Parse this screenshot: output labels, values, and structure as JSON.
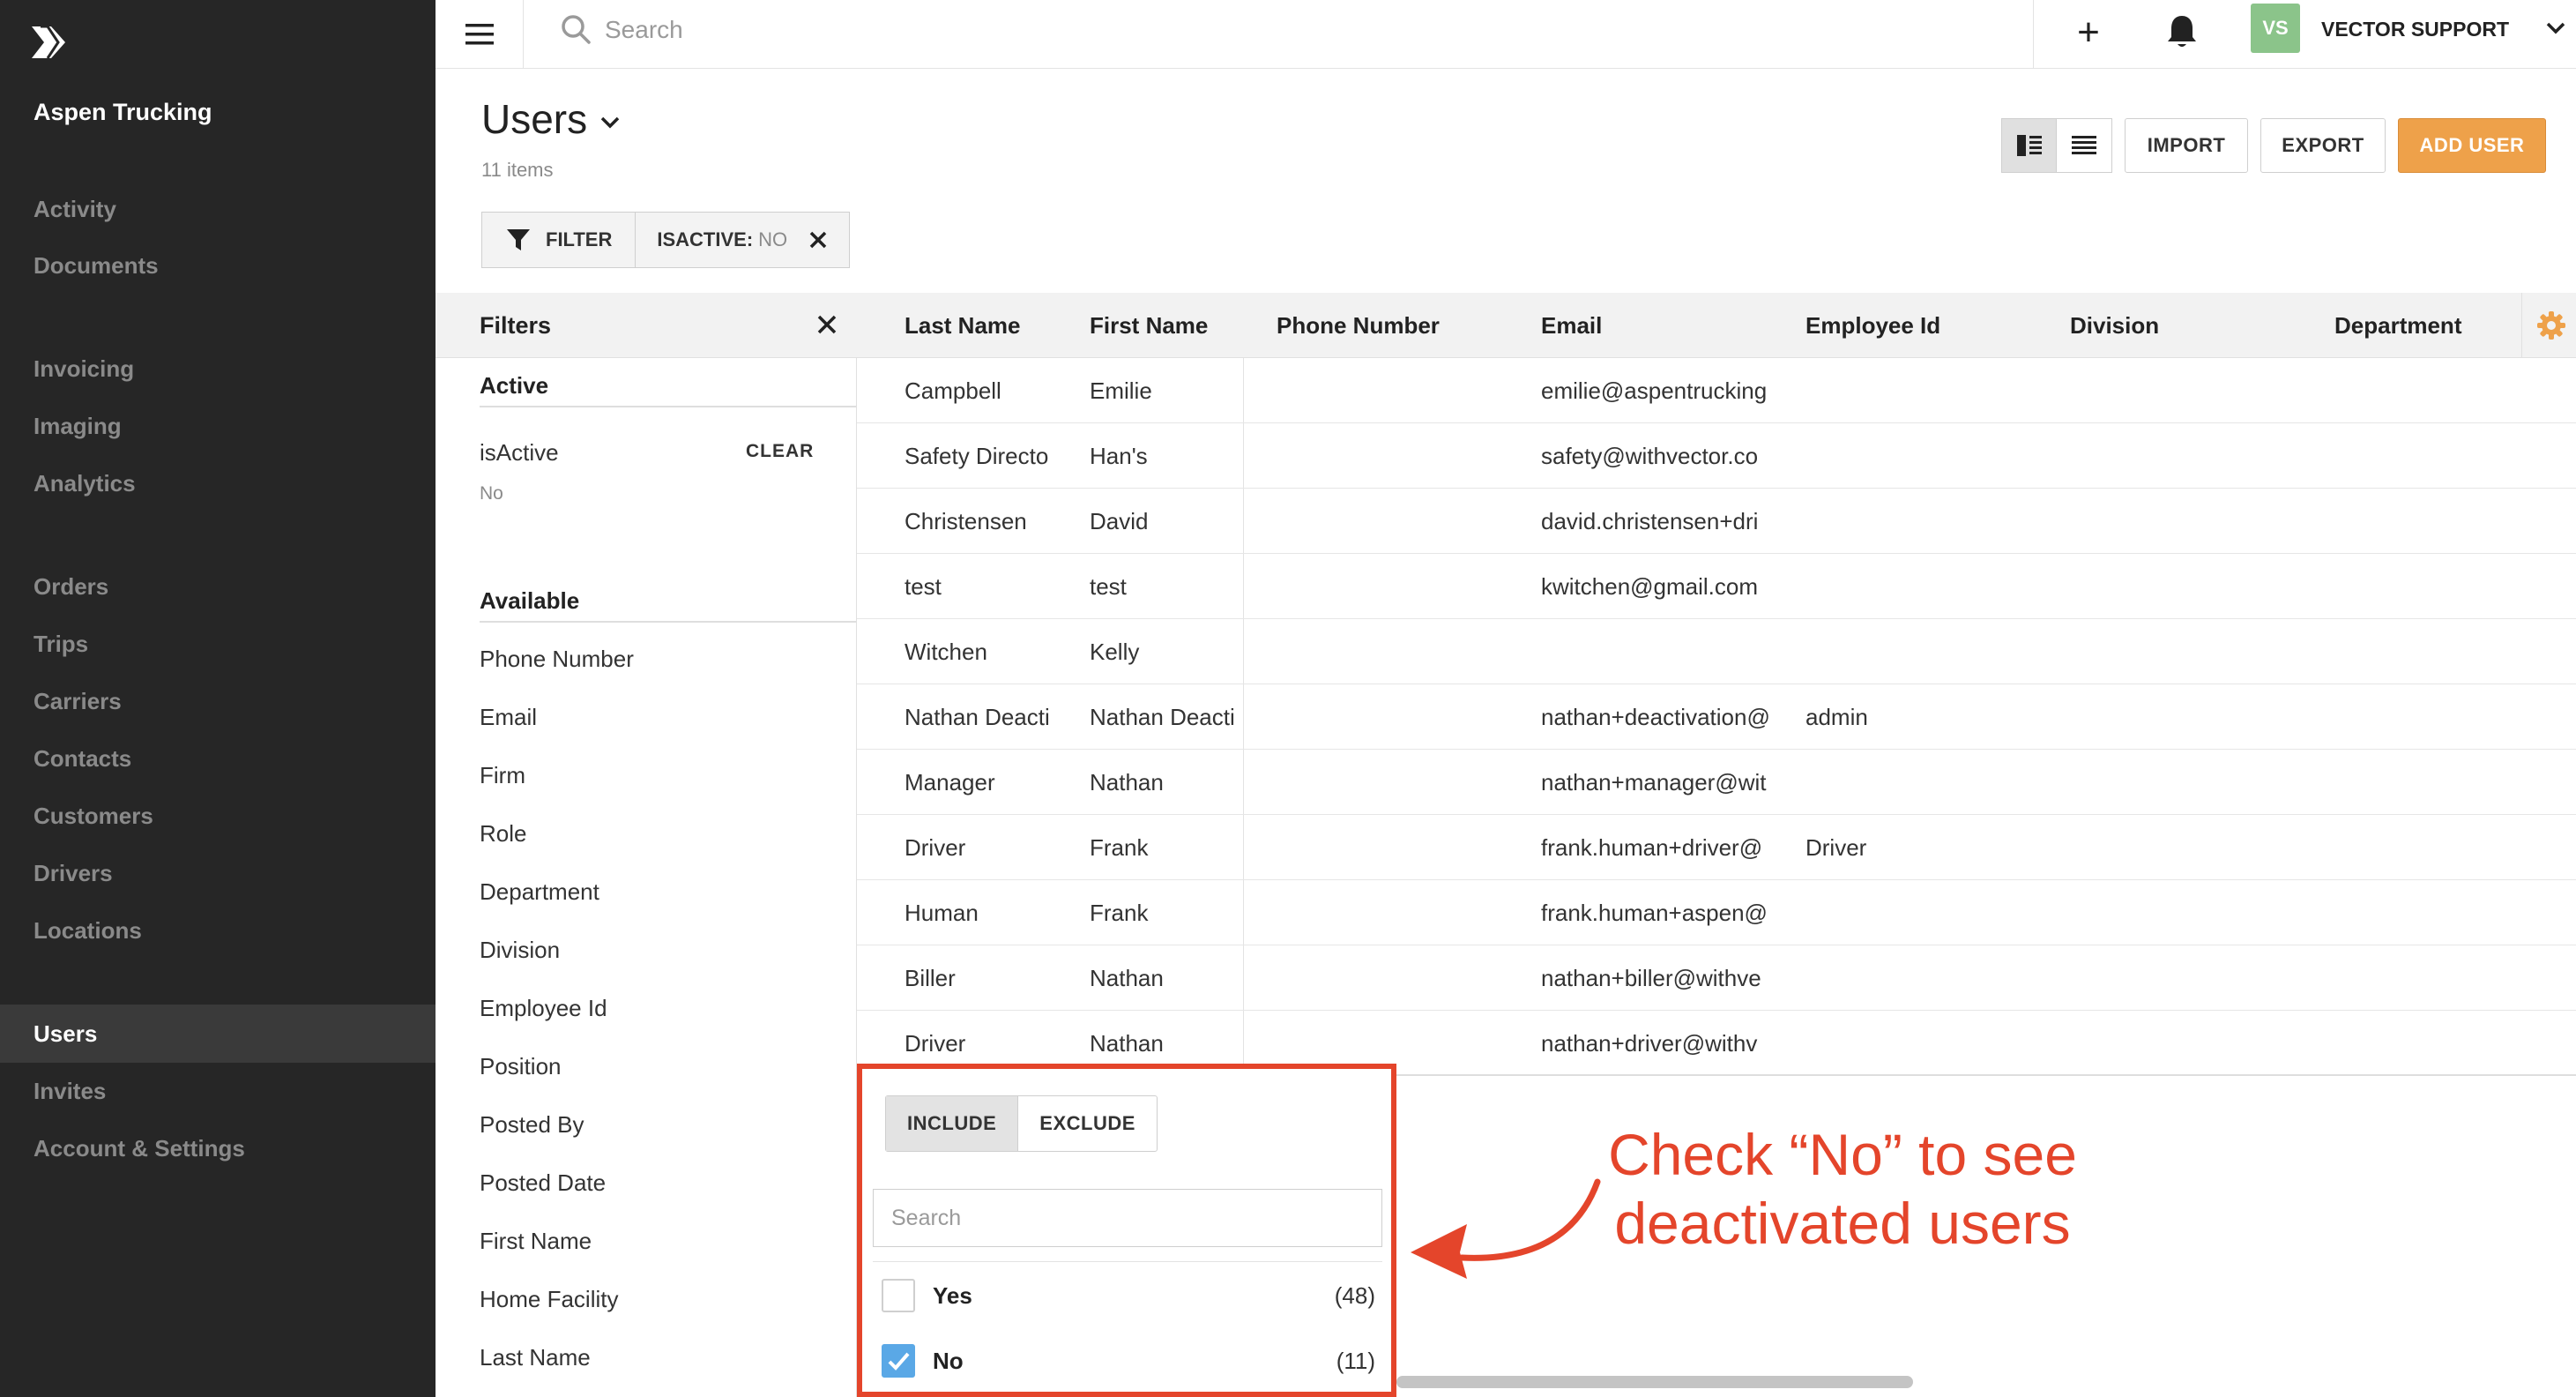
{
  "sidebar": {
    "org_name": "Aspen Trucking",
    "items": [
      {
        "label": "Activity",
        "name": "activity"
      },
      {
        "label": "Documents",
        "name": "documents"
      },
      {
        "label": "Invoicing",
        "name": "invoicing"
      },
      {
        "label": "Imaging",
        "name": "imaging"
      },
      {
        "label": "Analytics",
        "name": "analytics"
      },
      {
        "label": "Orders",
        "name": "orders"
      },
      {
        "label": "Trips",
        "name": "trips"
      },
      {
        "label": "Carriers",
        "name": "carriers"
      },
      {
        "label": "Contacts",
        "name": "contacts"
      },
      {
        "label": "Customers",
        "name": "customers"
      },
      {
        "label": "Drivers",
        "name": "drivers"
      },
      {
        "label": "Locations",
        "name": "locations"
      },
      {
        "label": "Users",
        "name": "users",
        "active": true
      },
      {
        "label": "Invites",
        "name": "invites"
      },
      {
        "label": "Account & Settings",
        "name": "account-settings"
      }
    ]
  },
  "topbar": {
    "search_placeholder": "Search",
    "avatar_initials": "VS",
    "avatar_color": "#8bc48a",
    "account_name": "VECTOR SUPPORT",
    "icons": [
      "menu-icon",
      "search-icon",
      "plus-icon",
      "bell-icon",
      "chevron-down-icon"
    ]
  },
  "page": {
    "title": "Users",
    "item_count": "11 items"
  },
  "toolbar": {
    "import_label": "IMPORT",
    "export_label": "EXPORT",
    "add_user_label": "ADD USER",
    "accent_color": "#eea14a"
  },
  "filter_bar": {
    "filter_label": "FILTER",
    "chip_key": "ISACTIVE:",
    "chip_value": "NO"
  },
  "filters_panel": {
    "title": "Filters",
    "active_section": "Active",
    "active_filter": {
      "field": "isActive",
      "clear_label": "CLEAR",
      "value": "No"
    },
    "available_section": "Available",
    "available": [
      "Phone Number",
      "Email",
      "Firm",
      "Role",
      "Department",
      "Division",
      "Employee Id",
      "Position",
      "Posted By",
      "Posted Date",
      "First Name",
      "Home Facility",
      "Last Name"
    ]
  },
  "table": {
    "columns": [
      "Last Name",
      "First Name",
      "Phone Number",
      "Email",
      "Employee Id",
      "Division",
      "Department"
    ],
    "rows": [
      {
        "last": "Campbell",
        "first": "Emilie",
        "phone": "",
        "email": "emilie@aspentrucking",
        "employee_id": ""
      },
      {
        "last": "Safety Directo",
        "first": "Han's",
        "phone": "",
        "email": "safety@withvector.co",
        "employee_id": ""
      },
      {
        "last": "Christensen",
        "first": "David",
        "phone": "",
        "email": "david.christensen+dri",
        "employee_id": ""
      },
      {
        "last": "test",
        "first": "test",
        "phone": "",
        "email": "kwitchen@gmail.com",
        "employee_id": ""
      },
      {
        "last": "Witchen",
        "first": "Kelly",
        "phone": "",
        "email": "",
        "employee_id": ""
      },
      {
        "last": "Nathan Deacti",
        "first": "Nathan Deacti",
        "phone": "",
        "email": "nathan+deactivation@",
        "employee_id": "admin"
      },
      {
        "last": "Manager",
        "first": "Nathan",
        "phone": "",
        "email": "nathan+manager@wit",
        "employee_id": ""
      },
      {
        "last": "Driver",
        "first": "Frank",
        "phone": "",
        "email": "frank.human+driver@",
        "employee_id": "Driver"
      },
      {
        "last": "Human",
        "first": "Frank",
        "phone": "",
        "email": "frank.human+aspen@",
        "employee_id": ""
      },
      {
        "last": "Biller",
        "first": "Nathan",
        "phone": "",
        "email": "nathan+biller@withve",
        "employee_id": ""
      },
      {
        "last": "Driver",
        "first": "Nathan",
        "phone": "",
        "email": "nathan+driver@withv",
        "employee_id": ""
      }
    ],
    "settings_icon_color": "#eea14a"
  },
  "facet_popup": {
    "include_label": "INCLUDE",
    "exclude_label": "EXCLUDE",
    "mode": "include",
    "search_placeholder": "Search",
    "options": [
      {
        "label": "Yes",
        "count": "(48)",
        "checked": false
      },
      {
        "label": "No",
        "count": "(11)",
        "checked": true
      }
    ],
    "highlight_color": "#e4452b"
  },
  "annotation": {
    "line1": "Check “No” to see",
    "line2": "deactivated users",
    "color": "#e4452b"
  }
}
